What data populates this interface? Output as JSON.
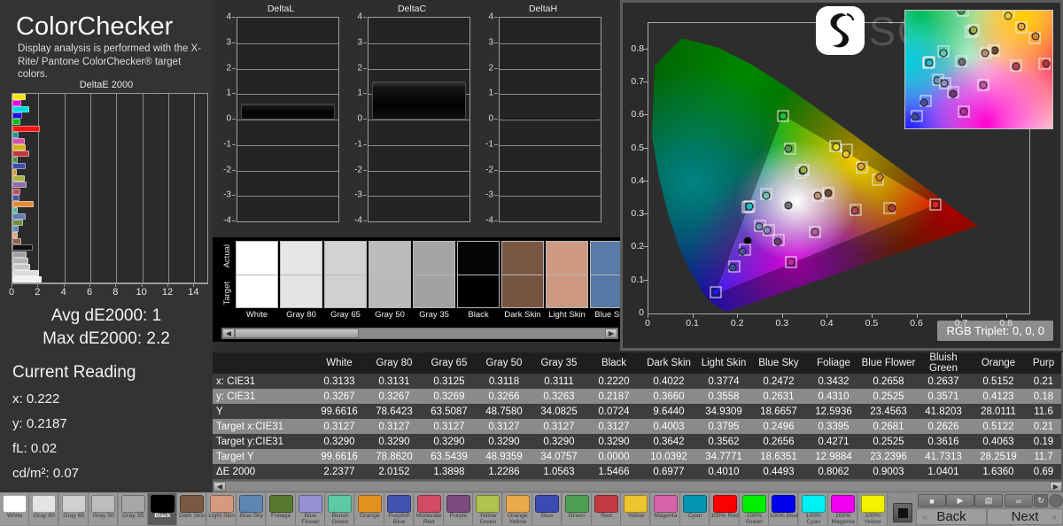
{
  "app": {
    "title": "ColorChecker",
    "subtitle": "Display analysis is performed with the X-Rite/\nPantone ColorChecker® target colors."
  },
  "delta_e_chart": {
    "title": "DeltaE 2000",
    "x_ticks": [
      "0",
      "2",
      "4",
      "6",
      "8",
      "10",
      "12",
      "14"
    ],
    "xlim": [
      0,
      15
    ]
  },
  "chart_data": [
    {
      "type": "bar",
      "title": "DeltaE 2000",
      "orientation": "horizontal",
      "xlabel": "",
      "ylabel": "",
      "xlim": [
        0,
        15
      ],
      "grid": true,
      "categories": [
        "100% Yellow",
        "100% Magenta",
        "100% Cyan",
        "100% Blue",
        "100% Green",
        "100% Red",
        "Cyan",
        "Magenta",
        "Yellow",
        "Red",
        "Green",
        "Blue",
        "Orange Yellow",
        "Yellow Green",
        "Purple",
        "Moderate Red",
        "Purplish Blue",
        "Orange",
        "Bluish Green",
        "Blue Flower",
        "Foliage",
        "Blue Sky",
        "Light Skin",
        "Dark Skin",
        "Black",
        "Gray 35",
        "Gray 50",
        "Gray 65",
        "Gray 80",
        "White"
      ],
      "values": [
        1.0,
        0.66,
        1.32,
        0.74,
        0.62,
        2.12,
        0.5,
        0.95,
        1.04,
        1.3,
        0.44,
        1.0,
        0.34,
        0.98,
        1.12,
        0.62,
        0.56,
        1.64,
        0.38,
        1.0,
        0.81,
        0.45,
        0.4,
        0.7,
        1.55,
        1.06,
        1.23,
        1.39,
        2.02,
        2.24
      ],
      "bar_colors": [
        "#f2e500",
        "#e300e3",
        "#00d8e2",
        "#1a13d4",
        "#00c018",
        "#f01414",
        "#1d8fa0",
        "#d052a8",
        "#d2b11d",
        "#bf3a3f",
        "#4d8d4a",
        "#3f4da8",
        "#d39a34",
        "#a8b343",
        "#8c6fa8",
        "#b5505c",
        "#4455a0",
        "#e08b3a",
        "#55b89a",
        "#5f7bb0",
        "#6f8b48",
        "#5f86b5",
        "#dba58c",
        "#8c6450",
        "#101010",
        "#a0a0a0",
        "#b4b4b4",
        "#c8c8c8",
        "#dcdcdc",
        "#f2f2f2"
      ]
    },
    {
      "type": "bar",
      "title": "DeltaL",
      "ylim": [
        -4,
        4
      ],
      "y_ticks": [
        "4",
        "3",
        "2",
        "1",
        "0",
        "-1",
        "-2",
        "-3",
        "-4"
      ],
      "categories": [
        "current"
      ],
      "values": [
        0.62
      ]
    },
    {
      "type": "bar",
      "title": "DeltaC",
      "ylim": [
        -4,
        4
      ],
      "y_ticks": [
        "4",
        "3",
        "2",
        "1",
        "0",
        "-1",
        "-2",
        "-3",
        "-4"
      ],
      "categories": [
        "current"
      ],
      "values": [
        1.5
      ]
    },
    {
      "type": "bar",
      "title": "DeltaH",
      "ylim": [
        -4,
        4
      ],
      "y_ticks": [
        "4",
        "3",
        "2",
        "1",
        "0",
        "-1",
        "-2",
        "-3",
        "-4"
      ],
      "categories": [
        "current"
      ],
      "values": [
        0.0
      ]
    },
    {
      "type": "scatter",
      "title": "CIE31 xy",
      "xlabel": "",
      "ylabel": "",
      "xlim": [
        0,
        0.85
      ],
      "ylim": [
        0,
        0.88
      ],
      "x_ticks": [
        "0",
        "0.1",
        "0.2",
        "0.3",
        "0.4",
        "0.5",
        "0.6",
        "0.7",
        "0.8"
      ],
      "y_ticks": [
        "0.1",
        "0.2",
        "0.3",
        "0.4",
        "0.5",
        "0.6",
        "0.7",
        "0.8"
      ],
      "annotation": "RGB Triplet: 0, 0, 0",
      "series": [
        {
          "name": "Measured (dot) / Target (square)",
          "points": [
            {
              "label": "White",
              "x": 0.3133,
              "y": 0.3267,
              "tx": 0.3127,
              "ty": 0.329,
              "color": "#6f6f6f"
            },
            {
              "label": "Black",
              "x": 0.222,
              "y": 0.2187,
              "tx": 0.15,
              "ty": 0.064,
              "color": "#000000"
            },
            {
              "label": "Dark Skin",
              "x": 0.4022,
              "y": 0.366,
              "tx": 0.4003,
              "ty": 0.3642,
              "color": "#6b4a38"
            },
            {
              "label": "Light Skin",
              "x": 0.3774,
              "y": 0.3558,
              "tx": 0.3795,
              "ty": 0.3562,
              "color": "#c08b72"
            },
            {
              "label": "Blue Sky",
              "x": 0.2472,
              "y": 0.2631,
              "tx": 0.2496,
              "ty": 0.2656,
              "color": "#6d8fb5"
            },
            {
              "label": "Foliage",
              "x": 0.3432,
              "y": 0.431,
              "tx": 0.3395,
              "ty": 0.4271,
              "color": "#5c7a42"
            },
            {
              "label": "Blue Flower",
              "x": 0.2658,
              "y": 0.2525,
              "tx": 0.2681,
              "ty": 0.2525,
              "color": "#8b8fc4"
            },
            {
              "label": "Bluish Green",
              "x": 0.2637,
              "y": 0.3571,
              "tx": 0.2626,
              "ty": 0.3616,
              "color": "#6ec2b0"
            },
            {
              "label": "Orange",
              "x": 0.5152,
              "y": 0.4123,
              "tx": 0.5122,
              "ty": 0.4063,
              "color": "#d4822f"
            },
            {
              "label": "Purplish Blue",
              "x": 0.21,
              "y": 0.188,
              "tx": 0.215,
              "ty": 0.193,
              "color": "#4a50a0"
            },
            {
              "label": "Moderate Red",
              "x": 0.46,
              "y": 0.31,
              "tx": 0.462,
              "ty": 0.315,
              "color": "#b4444f"
            },
            {
              "label": "Purple",
              "x": 0.289,
              "y": 0.218,
              "tx": 0.29,
              "ty": 0.223,
              "color": "#6a3f72"
            },
            {
              "label": "Yellow Green",
              "x": 0.345,
              "y": 0.434,
              "tx": 0.345,
              "ty": 0.434,
              "color": "#9bb24a"
            },
            {
              "label": "Orange Yellow",
              "x": 0.475,
              "y": 0.445,
              "tx": 0.476,
              "ty": 0.444,
              "color": "#dda342"
            },
            {
              "label": "Blue",
              "x": 0.187,
              "y": 0.14,
              "tx": 0.192,
              "ty": 0.142,
              "color": "#3b4f9e"
            },
            {
              "label": "Green",
              "x": 0.312,
              "y": 0.5,
              "tx": 0.316,
              "ty": 0.499,
              "color": "#4f9850"
            },
            {
              "label": "Red",
              "x": 0.543,
              "y": 0.319,
              "tx": 0.538,
              "ty": 0.32,
              "color": "#b4343c"
            },
            {
              "label": "Yellow",
              "x": 0.44,
              "y": 0.483,
              "tx": 0.442,
              "ty": 0.497,
              "color": "#e8c636"
            },
            {
              "label": "Magenta",
              "x": 0.371,
              "y": 0.246,
              "tx": 0.372,
              "ty": 0.247,
              "color": "#c05ba0"
            },
            {
              "label": "Cyan",
              "x": 0.225,
              "y": 0.324,
              "tx": 0.222,
              "ty": 0.323,
              "color": "#2a97b4"
            },
            {
              "label": "100% Red",
              "x": 0.64,
              "y": 0.329,
              "tx": 0.64,
              "ty": 0.33,
              "color": "#e8202a"
            },
            {
              "label": "100% Green",
              "x": 0.3,
              "y": 0.597,
              "tx": 0.3,
              "ty": 0.598,
              "color": "#20c030"
            },
            {
              "label": "100% Blue",
              "x": 0.15,
              "y": 0.064,
              "tx": 0.15,
              "ty": 0.064,
              "color": "#1a1ae0"
            },
            {
              "label": "100% Cyan",
              "x": 0.225,
              "y": 0.324,
              "tx": 0.225,
              "ty": 0.325,
              "color": "#25b8c8"
            },
            {
              "label": "100% Magenta",
              "x": 0.318,
              "y": 0.156,
              "tx": 0.318,
              "ty": 0.156,
              "color": "#c02c9c"
            },
            {
              "label": "100% Yellow",
              "x": 0.42,
              "y": 0.505,
              "tx": 0.418,
              "ty": 0.506,
              "color": "#e8d82a"
            }
          ]
        }
      ]
    }
  ],
  "summary": {
    "avg_label": "Avg dE2000: 1",
    "max_label": "Max dE2000: 2.2"
  },
  "current_reading": {
    "title": "Current Reading",
    "rows": [
      "x: 0.222",
      "y: 0.2187",
      "fL: 0.02",
      "cd/m²: 0.07"
    ]
  },
  "delta_charts": [
    {
      "title": "DeltaL",
      "value": 0.62
    },
    {
      "title": "DeltaC",
      "value": 1.5
    },
    {
      "title": "DeltaH",
      "value": 0.0
    }
  ],
  "delta_yticks": [
    "4",
    "3",
    "2",
    "1",
    "0",
    "-1",
    "-2",
    "-3",
    "-4"
  ],
  "swatch_compare": {
    "axis_labels": [
      "Actual",
      "Target"
    ],
    "items": [
      {
        "name": "White",
        "actual": "#ffffff",
        "target": "#ffffff"
      },
      {
        "name": "Gray 80",
        "actual": "#e6e6e6",
        "target": "#e4e4e4"
      },
      {
        "name": "Gray 65",
        "actual": "#d2d2d2",
        "target": "#d0d0d0"
      },
      {
        "name": "Gray 50",
        "actual": "#bcbcbc",
        "target": "#bababa"
      },
      {
        "name": "Gray 35",
        "actual": "#a4a4a4",
        "target": "#a2a2a2"
      },
      {
        "name": "Black",
        "actual": "#050508",
        "target": "#000000"
      },
      {
        "name": "Dark Skin",
        "actual": "#7a5742",
        "target": "#775440"
      },
      {
        "name": "Light Skin",
        "actual": "#cf9a82",
        "target": "#cd9880"
      },
      {
        "name": "Blue Sky",
        "actual": "#5a7ba8",
        "target": "#5878a5"
      }
    ]
  },
  "cie": {
    "title": "CIE31 xy",
    "rgb_triplet": "RGB Triplet: 0, 0, 0",
    "x_ticks": [
      "0",
      "0.1",
      "0.2",
      "0.3",
      "0.4",
      "0.5",
      "0.6",
      "0.7",
      "0.8"
    ],
    "y_ticks": [
      "0.1",
      "0.2",
      "0.3",
      "0.4",
      "0.5",
      "0.6",
      "0.7",
      "0.8"
    ],
    "watermark": "SOOMAL"
  },
  "table": {
    "columns": [
      "White",
      "Gray 80",
      "Gray 65",
      "Gray 50",
      "Gray 35",
      "Black",
      "Dark Skin",
      "Light Skin",
      "Blue Sky",
      "Foliage",
      "Blue Flower",
      "Bluish Green",
      "Orange",
      "Purp"
    ],
    "rows": [
      {
        "label": "x: CIE31",
        "values": [
          "0.3133",
          "0.3131",
          "0.3125",
          "0.3118",
          "0.3111",
          "0.2220",
          "0.4022",
          "0.3774",
          "0.2472",
          "0.3432",
          "0.2658",
          "0.2637",
          "0.5152",
          "0.21"
        ]
      },
      {
        "label": "y: CIE31",
        "values": [
          "0.3267",
          "0.3267",
          "0.3269",
          "0.3266",
          "0.3263",
          "0.2187",
          "0.3660",
          "0.3558",
          "0.2631",
          "0.4310",
          "0.2525",
          "0.3571",
          "0.4123",
          "0.18"
        ]
      },
      {
        "label": "Y",
        "values": [
          "99.6616",
          "78.6423",
          "63.5087",
          "48.7580",
          "34.0825",
          "0.0724",
          "9.6440",
          "34.9309",
          "18.6657",
          "12.5936",
          "23.4563",
          "41.8203",
          "28.0111",
          "11.6"
        ]
      },
      {
        "label": "Target x:CIE31",
        "values": [
          "0.3127",
          "0.3127",
          "0.3127",
          "0.3127",
          "0.3127",
          "0.3127",
          "0.4003",
          "0.3795",
          "0.2496",
          "0.3395",
          "0.2681",
          "0.2626",
          "0.5122",
          "0.21"
        ]
      },
      {
        "label": "Target y:CIE31",
        "values": [
          "0.3290",
          "0.3290",
          "0.3290",
          "0.3290",
          "0.3290",
          "0.3290",
          "0.3642",
          "0.3562",
          "0.2656",
          "0.4271",
          "0.2525",
          "0.3616",
          "0.4063",
          "0.19"
        ]
      },
      {
        "label": "Target Y",
        "values": [
          "99.6616",
          "78.8620",
          "63.5439",
          "48.9359",
          "34.0757",
          "0.0000",
          "10.0392",
          "34.7771",
          "18.6351",
          "12.9884",
          "23.2396",
          "41.7313",
          "28.2519",
          "11.7"
        ]
      },
      {
        "label": "ΔE 2000",
        "values": [
          "2.2377",
          "2.0152",
          "1.3898",
          "1.2286",
          "1.0563",
          "1.5466",
          "0.6977",
          "0.4010",
          "0.4493",
          "0.8062",
          "0.9003",
          "1.0401",
          "1.6360",
          "0.69"
        ]
      }
    ]
  },
  "bottom_swatches": [
    {
      "name": "White",
      "color": "#ffffff",
      "selected": false
    },
    {
      "name": "Gray 80",
      "color": "#e4e4e4",
      "selected": false
    },
    {
      "name": "Gray 65",
      "color": "#cfcfcf",
      "selected": false
    },
    {
      "name": "Gray 50",
      "color": "#bdbdbd",
      "selected": false
    },
    {
      "name": "Gray 35",
      "color": "#a7a7a7",
      "selected": false
    },
    {
      "name": "Black",
      "color": "#000000",
      "selected": true
    },
    {
      "name": "Dark Skin",
      "color": "#7b5843",
      "selected": false
    },
    {
      "name": "Light Skin",
      "color": "#d59b80",
      "selected": false
    },
    {
      "name": "Blue Sky",
      "color": "#5f86b3",
      "selected": false
    },
    {
      "name": "Foliage",
      "color": "#57792f",
      "selected": false
    },
    {
      "name": "Blue Flower",
      "color": "#9691d1",
      "selected": false
    },
    {
      "name": "Bluish Green",
      "color": "#5ec9a7",
      "selected": false
    },
    {
      "name": "Orange",
      "color": "#e4901f",
      "selected": false
    },
    {
      "name": "Purplish Blue",
      "color": "#4152b0",
      "selected": false
    },
    {
      "name": "Moderate Red",
      "color": "#d24a63",
      "selected": false
    },
    {
      "name": "Purple",
      "color": "#7b4a80",
      "selected": false
    },
    {
      "name": "Yellow Green",
      "color": "#b0c14e",
      "selected": false
    },
    {
      "name": "Orange Yellow",
      "color": "#eaa94a",
      "selected": false
    },
    {
      "name": "Blue",
      "color": "#3c4ab4",
      "selected": false
    },
    {
      "name": "Green",
      "color": "#4d9e55",
      "selected": false
    },
    {
      "name": "Red",
      "color": "#c43941",
      "selected": false
    },
    {
      "name": "Yellow",
      "color": "#edc52e",
      "selected": false
    },
    {
      "name": "Magenta",
      "color": "#d664ab",
      "selected": false
    },
    {
      "name": "Cyan",
      "color": "#0494b4",
      "selected": false
    },
    {
      "name": "100% Red",
      "color": "#fb0000",
      "selected": false
    },
    {
      "name": "100% Green",
      "color": "#00f000",
      "selected": false
    },
    {
      "name": "100% Blue",
      "color": "#0000ec",
      "selected": false
    },
    {
      "name": "100% Cyan",
      "color": "#00f2f2",
      "selected": false
    },
    {
      "name": "100% Magenta",
      "color": "#f200f2",
      "selected": false
    },
    {
      "name": "100% Yellow",
      "color": "#f2f200",
      "selected": false
    }
  ],
  "controls": {
    "stop_label": "■",
    "play_label": "▶",
    "save_label": "▤",
    "loop_label": "∞",
    "refresh_label": "↻",
    "back_label": "Back",
    "next_label": "Next",
    "back_chevron": "«",
    "next_chevron": "»"
  }
}
